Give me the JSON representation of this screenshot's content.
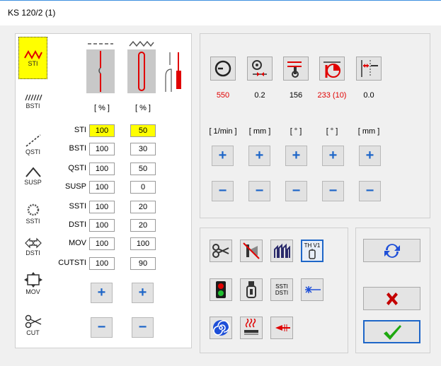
{
  "window": {
    "title": "KS 120/2 (1)"
  },
  "tabs": [
    {
      "label": "STI",
      "icon": "zigzag-stitch-icon",
      "active": true
    },
    {
      "label": "BSTI",
      "icon": "bartack-stitch-icon"
    },
    {
      "label": "QSTI",
      "icon": "diagonal-stitch-icon"
    },
    {
      "label": "SUSP",
      "icon": "suspend-stitch-icon"
    },
    {
      "label": "SSTI",
      "icon": "star-stitch-icon"
    },
    {
      "label": "DSTI",
      "icon": "double-arrow-stitch-icon"
    },
    {
      "label": "MOV",
      "icon": "move-frame-icon"
    },
    {
      "label": "CUT",
      "icon": "scissors-cut-icon"
    }
  ],
  "table": {
    "col_units": [
      "[ % ]",
      "[ % ]"
    ],
    "rows": [
      {
        "label": "STI",
        "v1": "100",
        "v2": "50",
        "highlight": true
      },
      {
        "label": "BSTI",
        "v1": "100",
        "v2": "30"
      },
      {
        "label": "QSTI",
        "v1": "100",
        "v2": "50"
      },
      {
        "label": "SUSP",
        "v1": "100",
        "v2": "0"
      },
      {
        "label": "SSTI",
        "v1": "100",
        "v2": "20"
      },
      {
        "label": "DSTI",
        "v1": "100",
        "v2": "20"
      },
      {
        "label": "MOV",
        "v1": "100",
        "v2": "100"
      },
      {
        "label": "CUTSTI",
        "v1": "100",
        "v2": "90"
      }
    ]
  },
  "params": [
    {
      "icon": "speed-gauge-icon",
      "value": "550",
      "unit": "[ 1/min ]",
      "color": "#e00000"
    },
    {
      "icon": "thread-tension-icon",
      "value": "0.2",
      "unit": "[ mm ]",
      "color": "#000000"
    },
    {
      "icon": "needle-angle-icon",
      "value": "156",
      "unit": "[ ° ]",
      "color": "#000000"
    },
    {
      "icon": "dial-angle-icon",
      "value": "233 (10)",
      "unit": "[ ° ]",
      "color": "#e00000"
    },
    {
      "icon": "needle-offset-icon",
      "value": "0.0",
      "unit": "[ mm ]",
      "color": "#000000"
    }
  ],
  "buttons": {
    "plus": "+",
    "minus": "−",
    "th_v1": "TH V1",
    "sstidsti_top": "SSTI",
    "sstidsti_bottom": "DSTI"
  },
  "colors": {
    "accent_blue": "#1e66c8",
    "highlight": "#ffff00",
    "red_value": "#e00000"
  }
}
